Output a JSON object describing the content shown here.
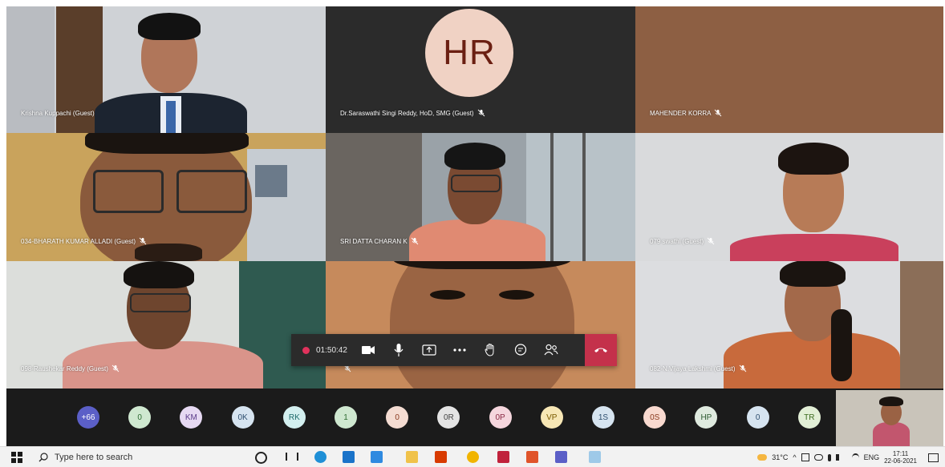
{
  "participants": [
    {
      "name": "Krishna Kuppachi (Guest)",
      "muted": false
    },
    {
      "name": "Dr.Saraswathi Singi Reddy, HoD, SMG (Guest)",
      "muted": true,
      "initials": "HR"
    },
    {
      "name": "MAHENDER KORRA",
      "muted": true
    },
    {
      "name": "034-BHARATH KUMAR ALLADI (Guest)",
      "muted": true
    },
    {
      "name": "SRI DATTA CHARAN K",
      "muted": true
    },
    {
      "name": "079 swathi (Guest)",
      "muted": true
    },
    {
      "name": "098-Raushekar Reddy (Guest)",
      "muted": true
    },
    {
      "name": "",
      "muted": true
    },
    {
      "name": "082-N.Vijaya Lakshmi (Guest)",
      "muted": true
    }
  ],
  "controls": {
    "timer": "01:50:42",
    "icons": [
      "camera-icon",
      "mic-icon",
      "share-screen-icon",
      "more-icon",
      "raise-hand-icon",
      "chat-icon",
      "participants-icon"
    ],
    "hangup_icon": "hang-up-icon"
  },
  "strip": {
    "chips": [
      {
        "label": "+66",
        "bg": "#5b5fc7",
        "fg": "#ffffff"
      },
      {
        "label": "0",
        "bg": "#cfe8d0",
        "fg": "#2e6b33"
      },
      {
        "label": "KM",
        "bg": "#e6d9f2",
        "fg": "#5b3c8a"
      },
      {
        "label": "0K",
        "bg": "#d6e4f0",
        "fg": "#2f4f6f"
      },
      {
        "label": "RK",
        "bg": "#d3efef",
        "fg": "#1f6b6b"
      },
      {
        "label": "1",
        "bg": "#cfe8d0",
        "fg": "#2e6b33"
      },
      {
        "label": "0",
        "bg": "#f4dcd2",
        "fg": "#8a3b20"
      },
      {
        "label": "0R",
        "bg": "#e4e4e4",
        "fg": "#444444"
      },
      {
        "label": "0P",
        "bg": "#f5d6dd",
        "fg": "#8a2a44"
      },
      {
        "label": "VP",
        "bg": "#f7e7b5",
        "fg": "#7a5a00"
      },
      {
        "label": "1S",
        "bg": "#d6e4f0",
        "fg": "#2f4f6f"
      },
      {
        "label": "0S",
        "bg": "#f8d9cf",
        "fg": "#8a3b20"
      },
      {
        "label": "HP",
        "bg": "#dfeadf",
        "fg": "#2e5b33"
      },
      {
        "label": "0",
        "bg": "#d6e4f0",
        "fg": "#2f4f6f"
      },
      {
        "label": "TR",
        "bg": "#e2efd6",
        "fg": "#3c6b1f"
      }
    ]
  },
  "taskbar": {
    "search_placeholder": "Type here to search",
    "temperature": "31°C",
    "language": "ENG",
    "time": "17:11",
    "date": "22-06-2021"
  }
}
